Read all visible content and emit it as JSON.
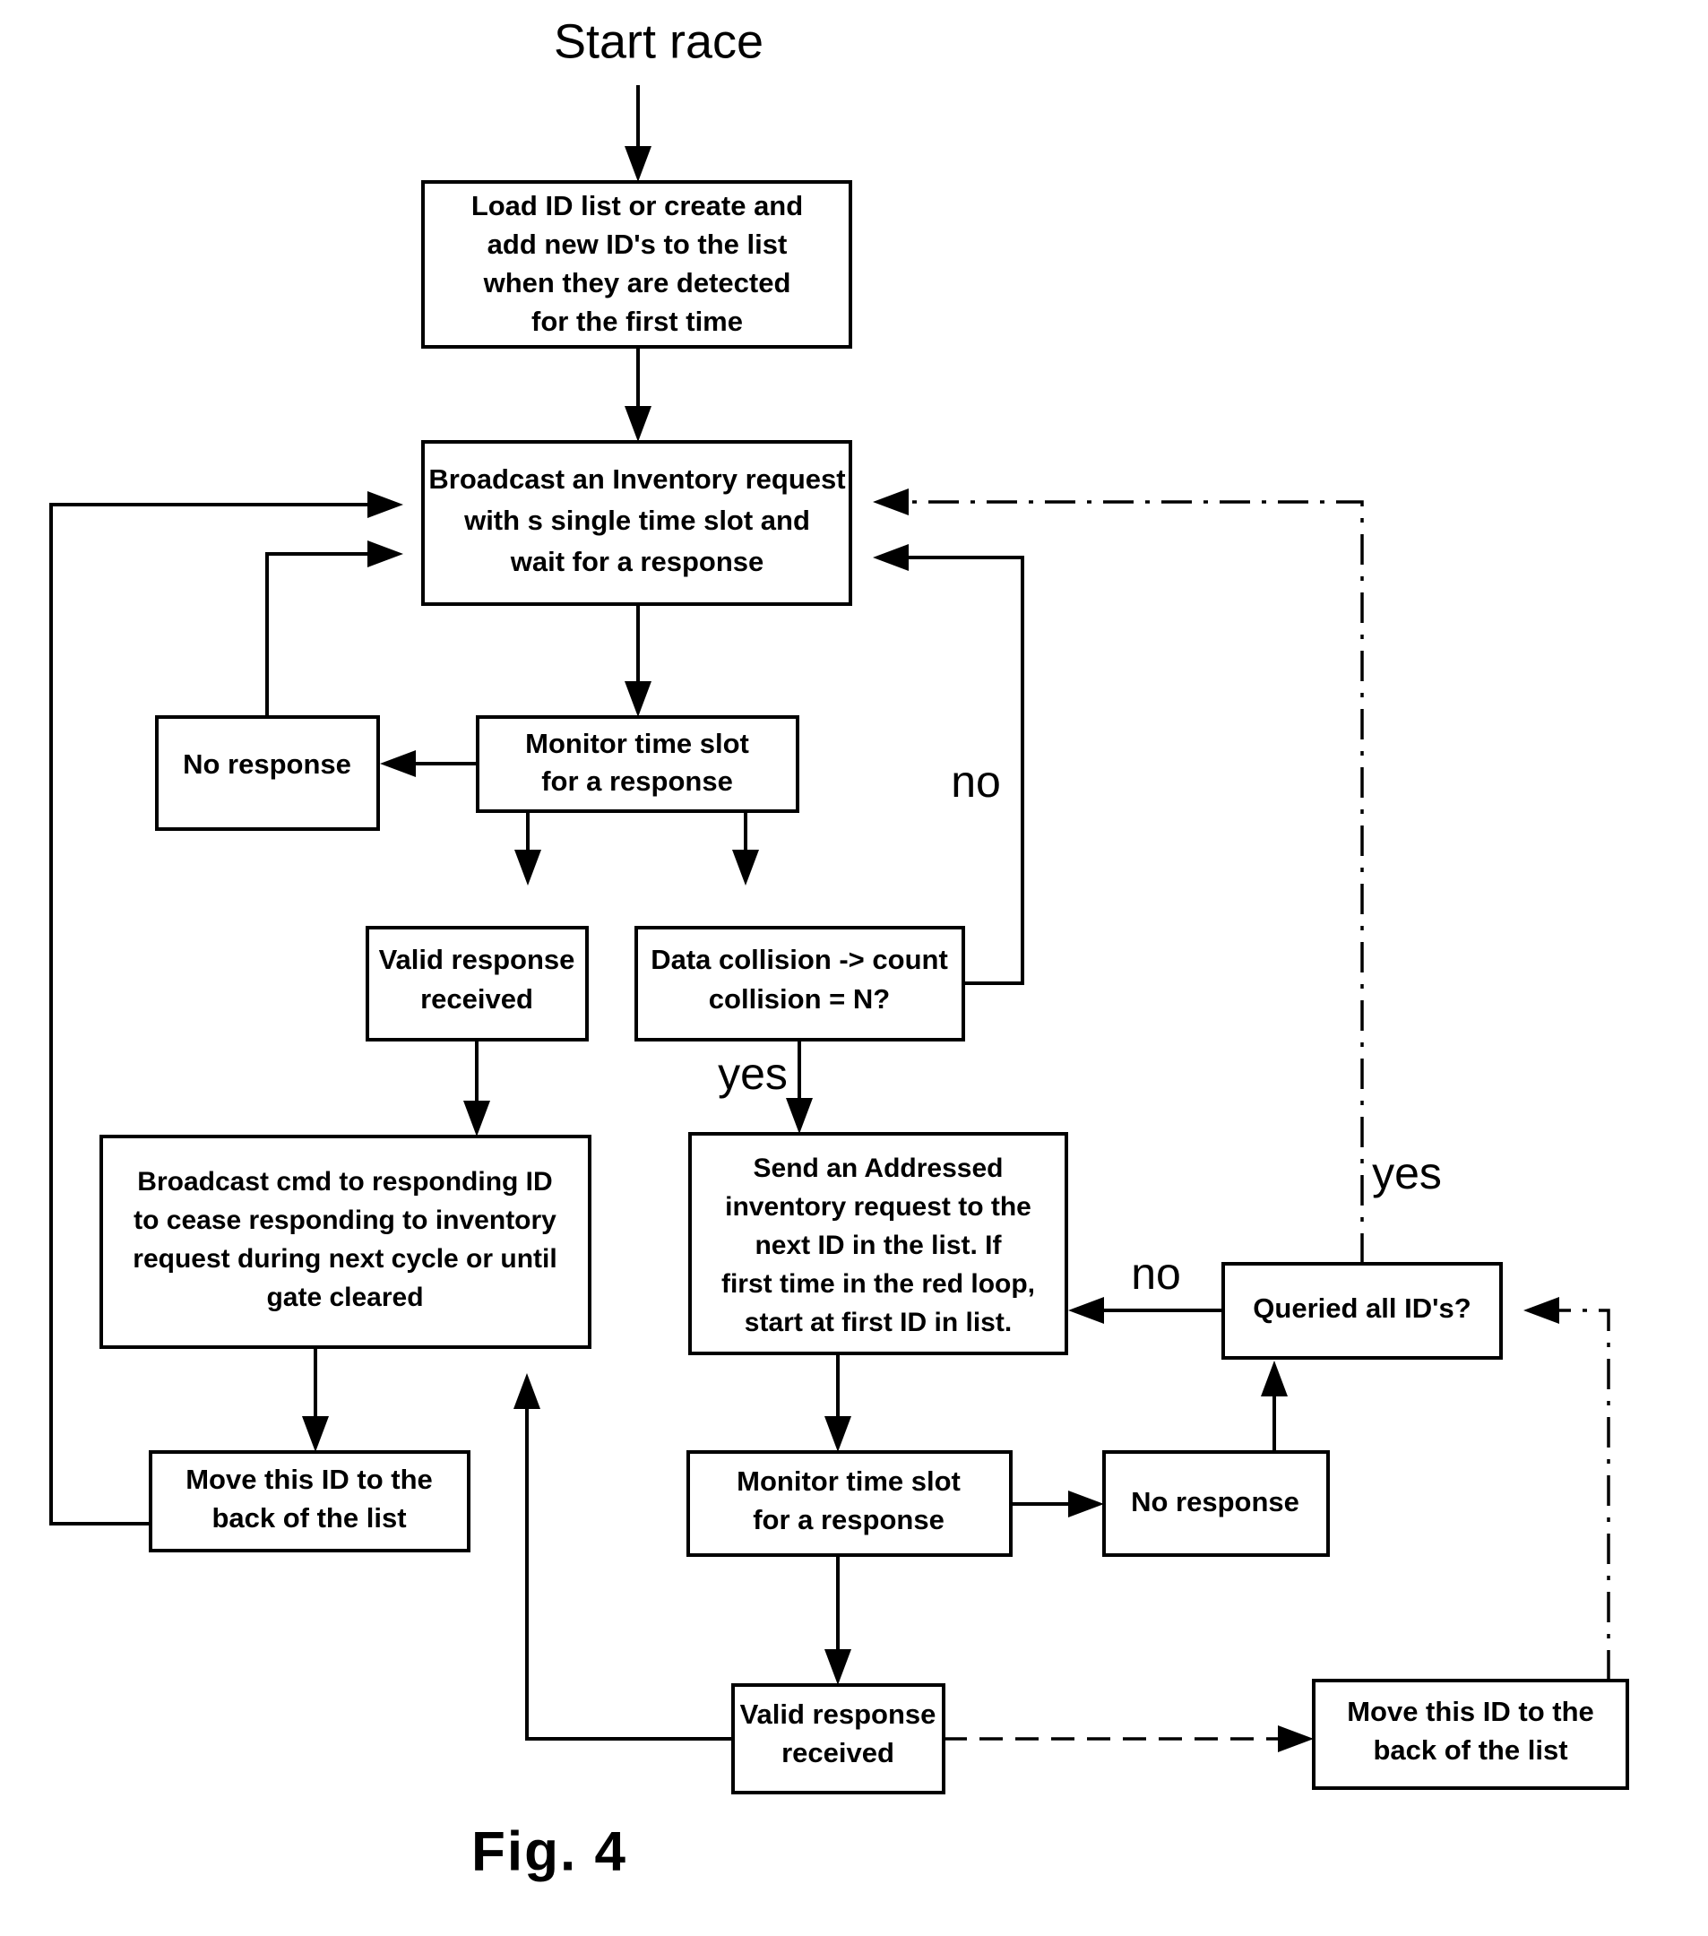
{
  "figure": {
    "caption": "Fig.  4",
    "start_label": "Start race"
  },
  "nodes": {
    "load_id_list": {
      "lines": [
        "Load ID list or create and",
        "add new ID's to the list",
        "when they are detected",
        "for the first time"
      ]
    },
    "broadcast_inventory": {
      "lines": [
        "Broadcast an Inventory request",
        "with s single time slot and",
        "wait for a response"
      ]
    },
    "no_response_top": {
      "lines": [
        "No response"
      ]
    },
    "monitor_slot_top": {
      "lines": [
        "Monitor time slot",
        "for a response"
      ]
    },
    "valid_response_left": {
      "lines": [
        "Valid response",
        "received"
      ]
    },
    "data_collision": {
      "lines": [
        "Data collision ->  count",
        "collision = N?"
      ]
    },
    "broadcast_cmd": {
      "lines": [
        "Broadcast cmd to responding ID",
        "to cease responding to inventory",
        "request during next cycle or until",
        "gate cleared"
      ]
    },
    "send_addressed": {
      "lines": [
        "Send an Addressed",
        "inventory request to the",
        "next ID in the list. If",
        "first time in the red  loop,",
        "start at first ID in list."
      ]
    },
    "queried_all": {
      "lines": [
        "Queried all ID's?"
      ]
    },
    "move_id_left": {
      "lines": [
        "Move this ID to the",
        "back of the list"
      ]
    },
    "monitor_slot_bottom": {
      "lines": [
        "Monitor time slot",
        "for a response"
      ]
    },
    "no_response_bottom": {
      "lines": [
        "No response"
      ]
    },
    "valid_response_bottom": {
      "lines": [
        "Valid response",
        "received"
      ]
    },
    "move_id_right": {
      "lines": [
        "Move this ID to the",
        "back of the list"
      ]
    }
  },
  "edge_labels": {
    "collision_no": "no",
    "collision_yes": "yes",
    "queried_no": "no",
    "queried_yes": "yes"
  },
  "colors": {
    "stroke": "#000000",
    "fill": "#ffffff",
    "text": "#000000"
  }
}
